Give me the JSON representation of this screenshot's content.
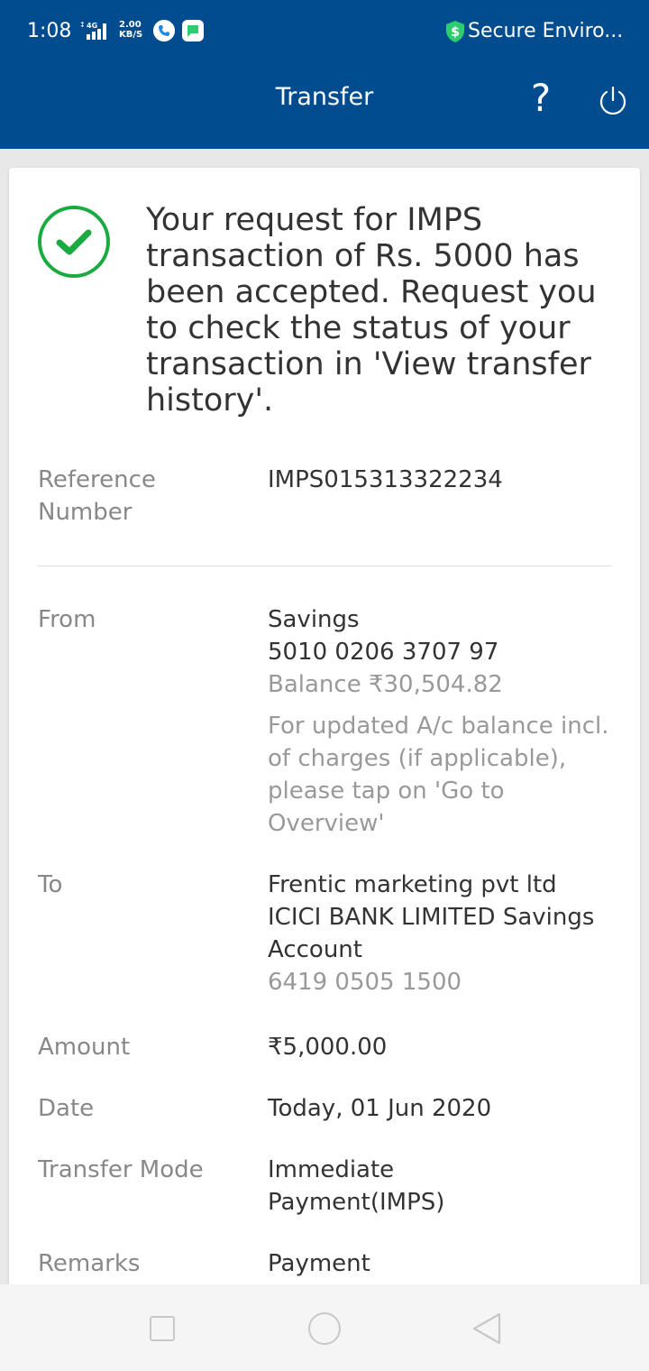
{
  "status_bar": {
    "time": "1:08",
    "speed": "2.00",
    "speed_unit": "KB/S",
    "network": "4G",
    "secure_text": "Secure Enviro..."
  },
  "header": {
    "title": "Transfer"
  },
  "confirmation": {
    "message": "Your request for IMPS transaction of Rs. 5000 has been accepted. Request you to check the status of your transaction in 'View transfer history'."
  },
  "details": {
    "reference": {
      "label_line1": "Reference",
      "label_line2": "Number",
      "value": "IMPS015313322234"
    },
    "from": {
      "label": "From",
      "account_type": "Savings",
      "account_number": "5010 0206 3707 97",
      "balance": "Balance ₹30,504.82",
      "note": "For updated A/c balance incl. of charges (if applicable), please tap on 'Go to Overview'"
    },
    "to": {
      "label": "To",
      "name": "Frentic marketing pvt ltd",
      "bank": "ICICI BANK LIMITED Savings Account",
      "account_number": "6419 0505 1500"
    },
    "amount": {
      "label": "Amount",
      "value": "₹5,000.00"
    },
    "date": {
      "label": "Date",
      "value": "Today, 01 Jun 2020"
    },
    "mode": {
      "label": "Transfer Mode",
      "value_line1": "Immediate",
      "value_line2": "Payment(IMPS)"
    },
    "remarks": {
      "label": "Remarks",
      "value": "Payment"
    }
  },
  "colors": {
    "brand_blue": "#004c8f",
    "success_green": "#1aab40",
    "secure_green": "#2ecc71"
  },
  "icons": {
    "help": "question-mark",
    "power": "power",
    "success": "check-circle",
    "nav": [
      "square",
      "circle",
      "back-triangle"
    ]
  }
}
